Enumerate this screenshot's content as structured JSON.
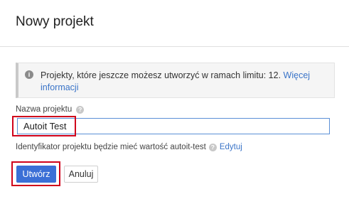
{
  "dialog": {
    "title": "Nowy projekt"
  },
  "info": {
    "text": "Projekty, które jeszcze możesz utworzyć w ramach limitu: 12. ",
    "link": "Więcej informacji"
  },
  "form": {
    "name_label": "Nazwa projektu",
    "name_value": "Autoit Test",
    "id_text": "Identyfikator projektu będzie mieć wartość autoit-test",
    "edit_link": "Edytuj"
  },
  "buttons": {
    "create": "Utwórz",
    "cancel": "Anuluj"
  },
  "colors": {
    "primary": "#3b6fd6",
    "link": "#3a74c8",
    "annotation": "#d0021b"
  }
}
